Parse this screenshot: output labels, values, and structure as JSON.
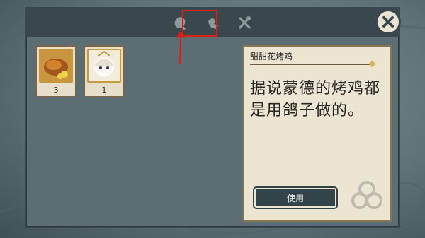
{
  "tabs": [
    {
      "name": "food",
      "icon": "drumstick-icon",
      "active": true
    },
    {
      "name": "materials",
      "icon": "ore-icon",
      "active": false
    },
    {
      "name": "tools",
      "icon": "tools-icon",
      "active": false
    }
  ],
  "items": [
    {
      "name": "roast-chicken",
      "icon": "roast-chicken-icon",
      "count": "3"
    },
    {
      "name": "paimon-badge",
      "icon": "character-portrait-icon",
      "count": "1"
    }
  ],
  "detail": {
    "title": "甜甜花烤鸡",
    "description": "据说蒙德的烤鸡都是用鸽子做的。",
    "use_label": "使用"
  },
  "colors": {
    "panel_bg": "#5c6e73",
    "tabbar_bg": "#3a484d",
    "card_bg": "#ece5d2",
    "highlight": "#d8201b",
    "button_bg": "#33434a"
  }
}
